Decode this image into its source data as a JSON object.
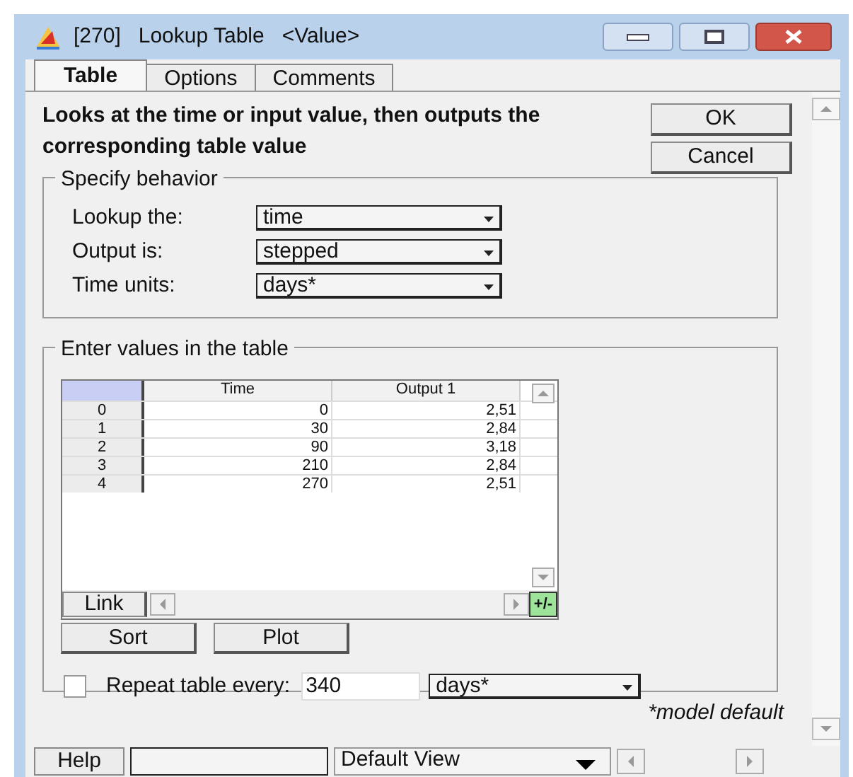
{
  "window": {
    "title": "[270]   Lookup Table   <Value>"
  },
  "tabs": [
    {
      "label": "Table",
      "selected": true
    },
    {
      "label": "Options",
      "selected": false
    },
    {
      "label": "Comments",
      "selected": false
    }
  ],
  "description": "Looks at the time or input  value, then outputs the corresponding table value",
  "buttons": [
    "OK",
    "Cancel"
  ],
  "behavior": {
    "title": "Specify behavior",
    "fields": [
      {
        "label": "Lookup the:",
        "value": "time"
      },
      {
        "label": "Output is:",
        "value": "stepped"
      },
      {
        "label": "Time units:",
        "value": "days*"
      }
    ]
  },
  "table_group": {
    "title": "Enter values in the table",
    "table": {
      "columns": [
        "Time",
        "Output 1"
      ],
      "rows": [
        {
          "index": "0",
          "cells": [
            "0",
            "2,51"
          ]
        },
        {
          "index": "1",
          "cells": [
            "30",
            "2,84"
          ]
        },
        {
          "index": "2",
          "cells": [
            "90",
            "3,18"
          ]
        },
        {
          "index": "3",
          "cells": [
            "210",
            "2,84"
          ]
        },
        {
          "index": "4",
          "cells": [
            "270",
            "2,51"
          ]
        }
      ]
    },
    "link_button": "Link",
    "add_remove_button": "+/-",
    "actions": [
      "Sort",
      "Plot"
    ],
    "repeat": {
      "checked": false,
      "label": "Repeat table every:",
      "value": "340",
      "unit": "days*"
    }
  },
  "footnote": "*model default",
  "bottom_bar": {
    "help": "Help",
    "view": "Default View"
  }
}
